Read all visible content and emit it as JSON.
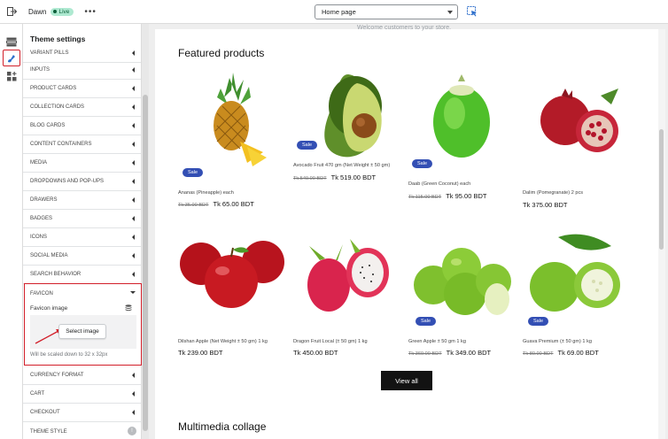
{
  "topbar": {
    "theme_name": "Dawn",
    "live_badge": "Live",
    "more_label": "•••",
    "page_select_value": "Home page"
  },
  "sidebar": {
    "title": "Theme settings",
    "sections": [
      {
        "label": "VARIANT PILLS"
      },
      {
        "label": "INPUTS"
      },
      {
        "label": "PRODUCT CARDS"
      },
      {
        "label": "COLLECTION CARDS"
      },
      {
        "label": "BLOG CARDS"
      },
      {
        "label": "CONTENT CONTAINERS"
      },
      {
        "label": "MEDIA"
      },
      {
        "label": "DROPDOWNS AND POP-UPS"
      },
      {
        "label": "DRAWERS"
      },
      {
        "label": "BADGES"
      },
      {
        "label": "ICONS"
      },
      {
        "label": "SOCIAL MEDIA"
      },
      {
        "label": "SEARCH BEHAVIOR"
      },
      {
        "label": "FAVICON"
      },
      {
        "label": "CURRENCY FORMAT"
      },
      {
        "label": "CART"
      },
      {
        "label": "CHECKOUT"
      },
      {
        "label": "THEME STYLE"
      }
    ],
    "favicon": {
      "field_label": "Favicon image",
      "select_button": "Select image",
      "note": "Will be scaled down to 32 x 32px"
    },
    "theme_style_badge": "!"
  },
  "preview": {
    "welcome_text": "Welcome customers to your store.",
    "featured_title": "Featured products",
    "view_all": "View all",
    "multimedia_title": "Multimedia collage",
    "sale_label": "Sale",
    "products": [
      {
        "name": "Ananas (Pineapple) each",
        "compare": "Tk 35.00 BDT",
        "price": "Tk 65.00 BDT",
        "sale": true
      },
      {
        "name": "Avocado Fruit 470 gm (Net Weight ± 50 gm)",
        "compare": "Tk 549.00 BDT",
        "price": "Tk 519.00 BDT",
        "sale": true
      },
      {
        "name": "Daab (Green Coconut) each",
        "compare": "Tk 115.00 BDT",
        "price": "Tk 95.00 BDT",
        "sale": true
      },
      {
        "name": "Dalim (Pomegranate) 2 pcs",
        "compare": "",
        "price": "Tk 375.00 BDT",
        "sale": false
      },
      {
        "name": "Dilshan Apple (Net Weight ± 50 gm) 1 kg",
        "compare": "",
        "price": "Tk 239.00 BDT",
        "sale": false
      },
      {
        "name": "Dragon Fruit Local (± 50 gm) 1 kg",
        "compare": "",
        "price": "Tk 450.00 BDT",
        "sale": false
      },
      {
        "name": "Green Apple ± 50 gm 1 kg",
        "compare": "Tk 369.00 BDT",
        "price": "Tk 349.00 BDT",
        "sale": true
      },
      {
        "name": "Guava Premium (± 50 gm) 1 kg",
        "compare": "Tk 80.00 BDT",
        "price": "Tk 69.00 BDT",
        "sale": true
      }
    ]
  },
  "colors": {
    "accent_red": "#d21f2a",
    "sale_badge": "#334fb4",
    "live_badge": "#aee9d1"
  }
}
